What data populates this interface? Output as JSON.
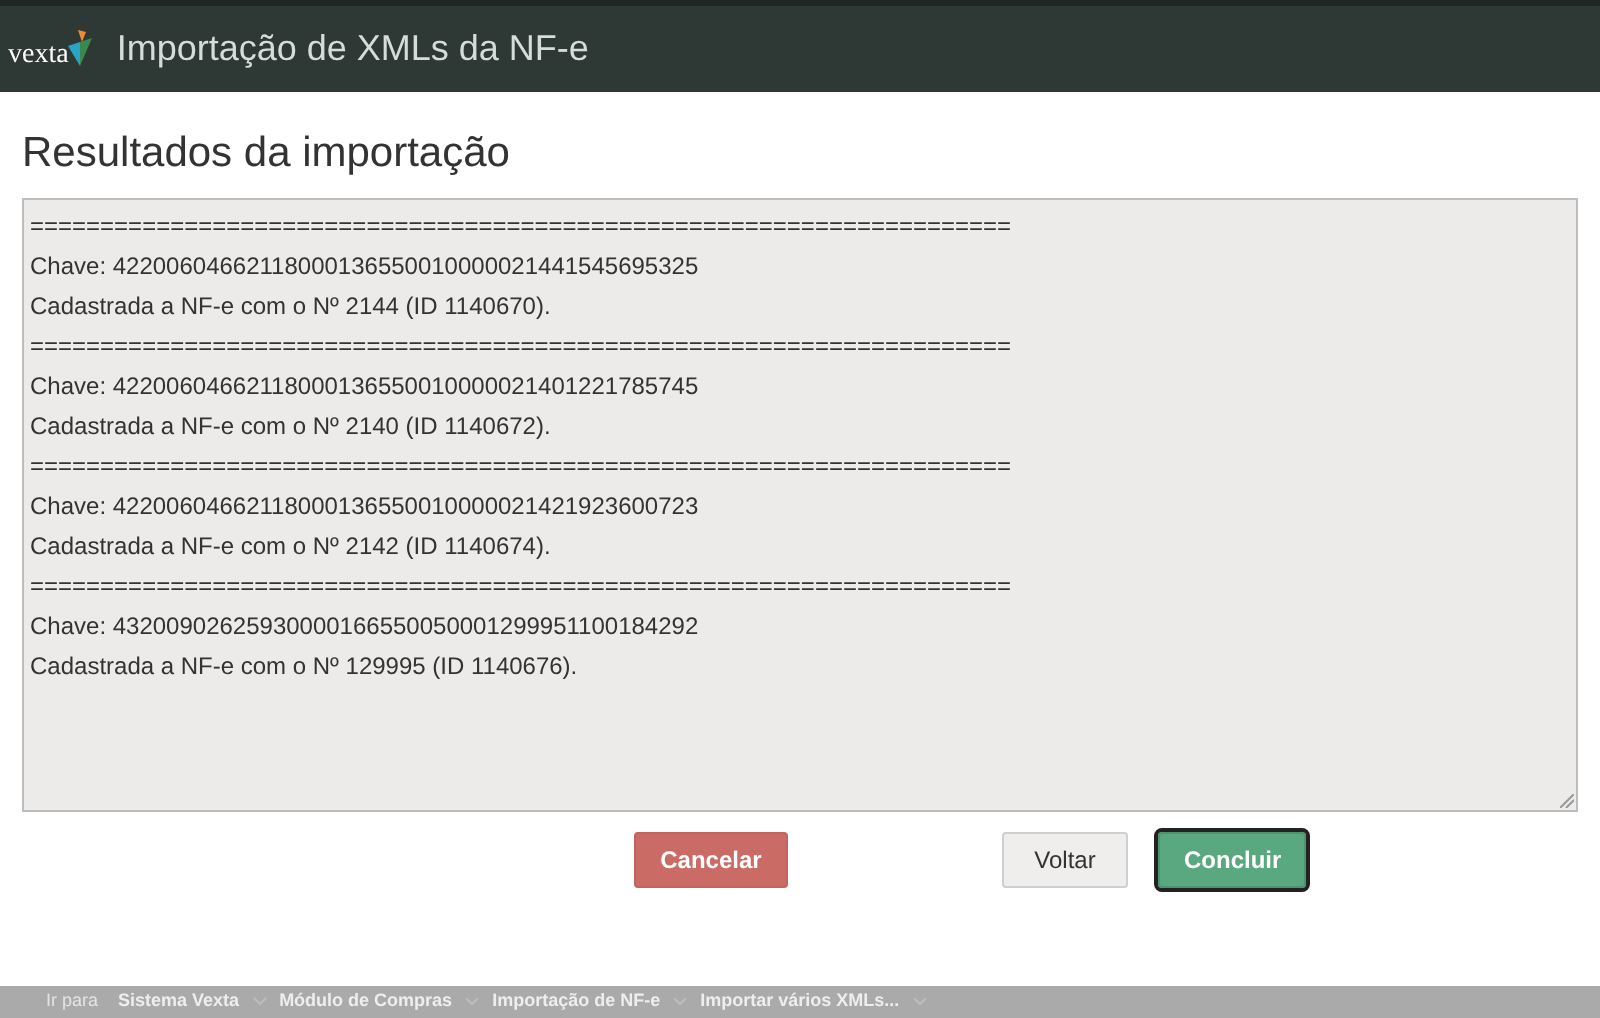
{
  "header": {
    "logo": "vexta",
    "title": "Importação de XMLs da NF-e"
  },
  "page_title": "Resultados da importação",
  "results": [
    "======================================================================",
    "Chave: 42200604662118000136550010000021441545695325",
    "Cadastrada a NF-e com o Nº 2144 (ID 1140670).",
    "======================================================================",
    "Chave: 42200604662118000136550010000021401221785745",
    "Cadastrada a NF-e com o Nº 2140 (ID 1140672).",
    "======================================================================",
    "Chave: 42200604662118000136550010000021421923600723",
    "Cadastrada a NF-e com o Nº 2142 (ID 1140674).",
    "======================================================================",
    "Chave: 43200902625930000166550050001299951100184292",
    "Cadastrada a NF-e com o Nº 129995 (ID 1140676)."
  ],
  "buttons": [
    {
      "label": "Cancelar",
      "kind": "danger",
      "focused": false
    },
    {
      "label": "Voltar",
      "kind": "default",
      "focused": false
    },
    {
      "label": "Concluir",
      "kind": "success",
      "focused": true
    }
  ],
  "breadcrumb": {
    "label": "Ir para",
    "items": [
      "Sistema Vexta",
      "Módulo de Compras",
      "Importação de NF-e",
      "Importar vários XMLs..."
    ]
  }
}
